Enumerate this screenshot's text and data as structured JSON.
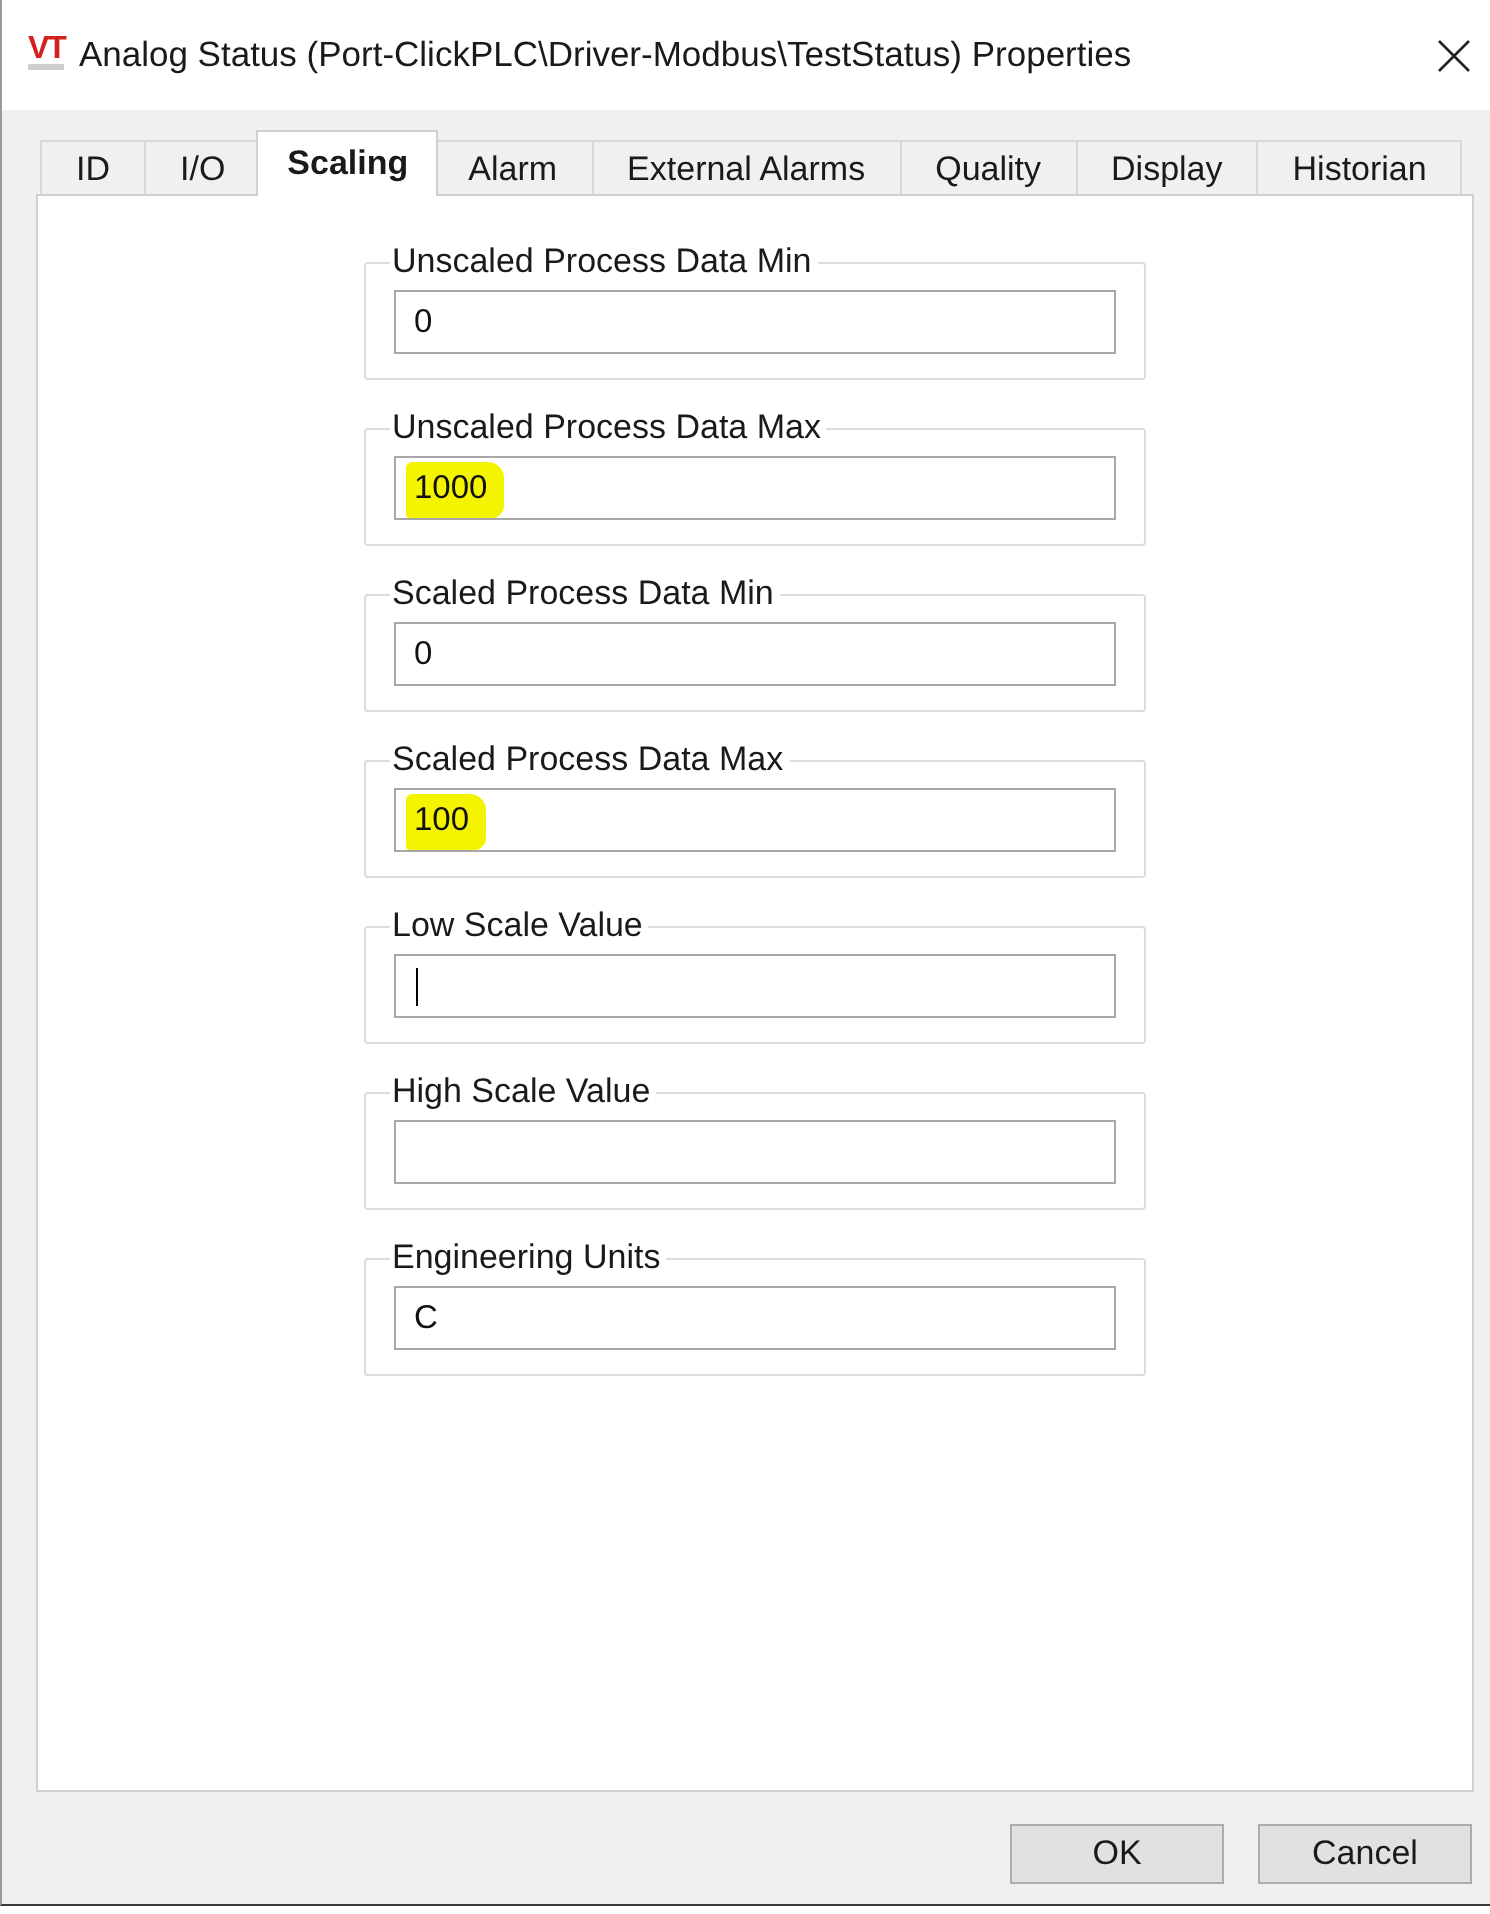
{
  "window": {
    "logo_text": "VT",
    "title": "Analog Status (Port-ClickPLC\\Driver-Modbus\\TestStatus) Properties"
  },
  "tabs": [
    {
      "label": "ID",
      "selected": false
    },
    {
      "label": "I/O",
      "selected": false
    },
    {
      "label": "Scaling",
      "selected": true
    },
    {
      "label": "Alarm",
      "selected": false
    },
    {
      "label": "External Alarms",
      "selected": false
    },
    {
      "label": "Quality",
      "selected": false
    },
    {
      "label": "Display",
      "selected": false
    },
    {
      "label": "Historian",
      "selected": false
    }
  ],
  "fields": [
    {
      "label": "Unscaled Process Data Min",
      "value": "0",
      "highlighted": false,
      "focused": false
    },
    {
      "label": "Unscaled Process Data Max",
      "value": "1000",
      "highlighted": true,
      "focused": false
    },
    {
      "label": "Scaled Process Data Min",
      "value": "0",
      "highlighted": false,
      "focused": false
    },
    {
      "label": "Scaled Process Data Max",
      "value": "100",
      "highlighted": true,
      "focused": false
    },
    {
      "label": "Low Scale Value",
      "highlighted": false,
      "focused": true
    },
    {
      "label": "High Scale Value",
      "highlighted": false,
      "focused": false
    },
    {
      "label": "Engineering Units",
      "value": "C",
      "highlighted": false,
      "focused": false
    }
  ],
  "buttons": [
    {
      "label": "OK"
    },
    {
      "label": "Cancel"
    }
  ]
}
